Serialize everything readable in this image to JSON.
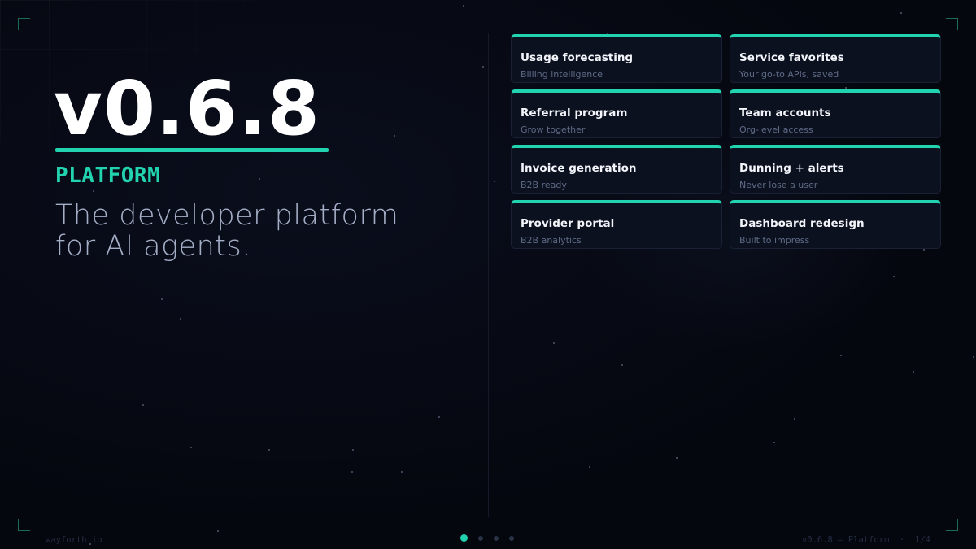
{
  "slide": {
    "version": "v0.6.8",
    "section": "PLATFORM",
    "tagline_lines": [
      "The developer platform",
      "for AI agents."
    ]
  },
  "cards": [
    {
      "title": "Usage forecasting",
      "subtitle": "Billing intelligence"
    },
    {
      "title": "Service favorites",
      "subtitle": "Your go-to APIs, saved"
    },
    {
      "title": "Referral program",
      "subtitle": "Grow together"
    },
    {
      "title": "Team accounts",
      "subtitle": "Org-level access"
    },
    {
      "title": "Invoice generation",
      "subtitle": "B2B ready"
    },
    {
      "title": "Dunning + alerts",
      "subtitle": "Never lose a user"
    },
    {
      "title": "Provider portal",
      "subtitle": "B2B analytics"
    },
    {
      "title": "Dashboard redesign",
      "subtitle": "Built to impress"
    }
  ],
  "footer": {
    "brand": "wayforth.io",
    "meta": "v0.6.8 — Platform  ·  1/4"
  },
  "pager": {
    "total": 4,
    "active": 1
  },
  "colors": {
    "accent": "#22d3b0",
    "background": "#05070f",
    "card_background": "#0c1120",
    "tagline": "#a4aec6",
    "card_subtitle": "#5f6b86"
  }
}
